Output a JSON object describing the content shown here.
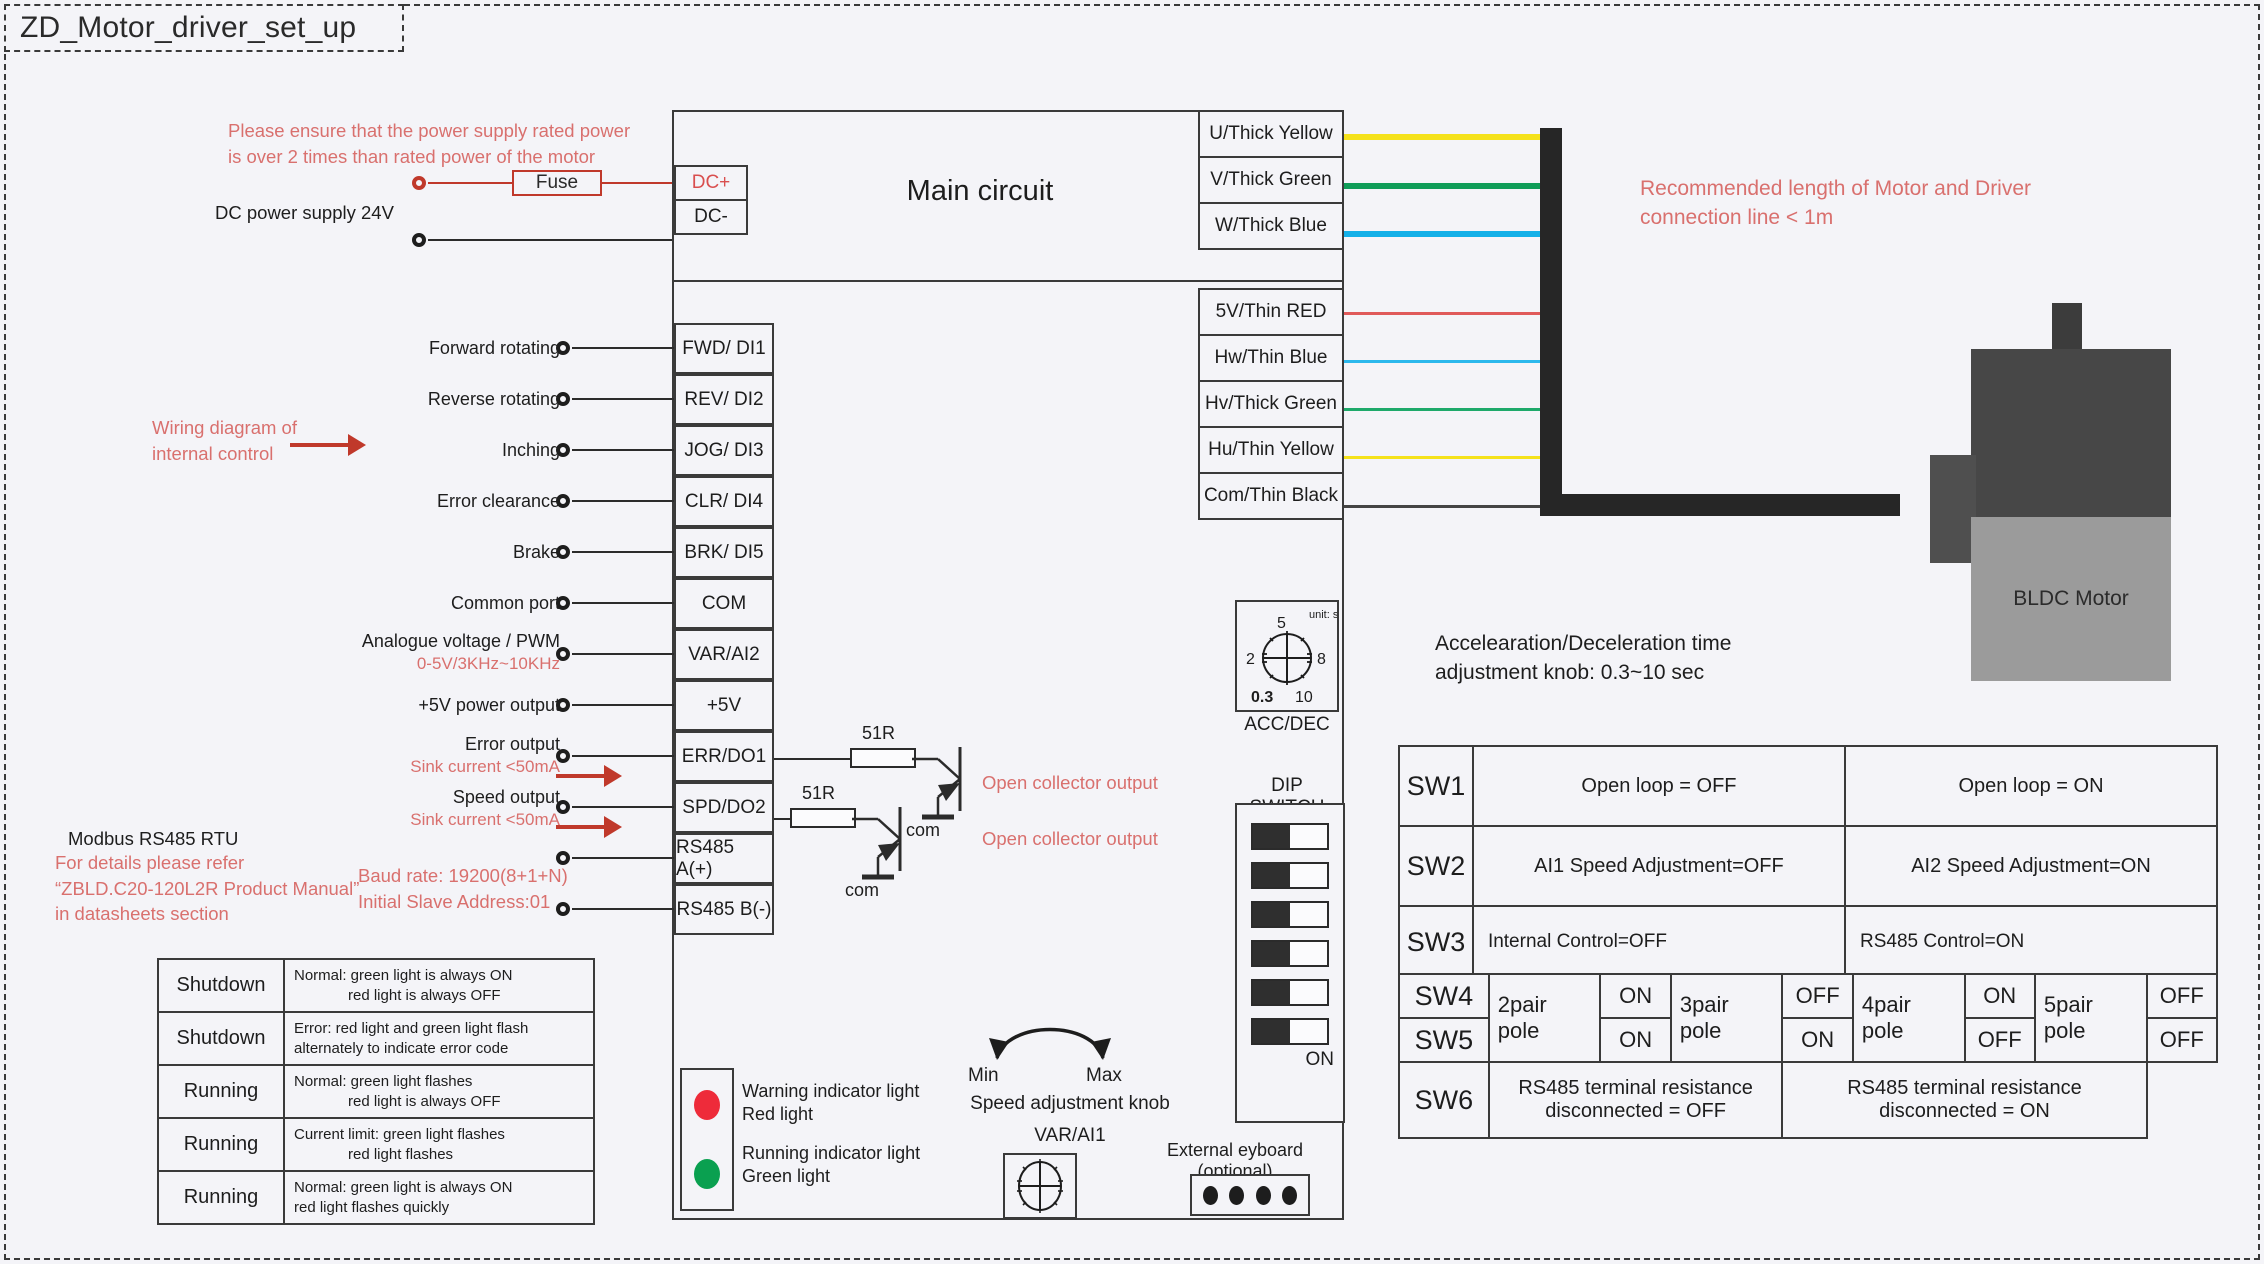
{
  "title": "ZD_Motor_driver_set_up",
  "notes": {
    "power_supply_warning": "Please ensure that the power supply rated power\nis over 2 times than rated power of the motor",
    "dc_supply": "DC power supply 24V",
    "fuse": "Fuse",
    "wiring_internal": "Wiring diagram of\ninternal control",
    "modbus": "Modbus RS485 RTU",
    "modbus_refer": "For details please refer\n“ZBLD.C20-120L2R Product Manual”\nin datasheets section",
    "baud": "Baud rate: 19200(8+1+N)\nInitial Slave Address:01",
    "recommended_length": "Recommended length of Motor and Driver\nconnection line < 1m",
    "accdec_text": "Accelearation/Deceleration time\nadjustment knob: 0.3~10 sec",
    "open_collector_1": "Open collector output",
    "open_collector_2": "Open collector output",
    "resistor_1": "51R",
    "resistor_2": "51R",
    "com_1": "com",
    "com_2": "com"
  },
  "main_circuit": {
    "label": "Main circuit"
  },
  "power_terminals": [
    {
      "label": "DC+",
      "red": true
    },
    {
      "label": "DC-",
      "red": false
    }
  ],
  "control_terminals": [
    {
      "label": "FWD/ DI1",
      "left": "Forward rotating",
      "sub": ""
    },
    {
      "label": "REV/ DI2",
      "left": "Reverse rotating",
      "sub": ""
    },
    {
      "label": "JOG/ DI3",
      "left": "Inching",
      "sub": ""
    },
    {
      "label": "CLR/ DI4",
      "left": "Error clearance",
      "sub": ""
    },
    {
      "label": "BRK/ DI5",
      "left": "Brake",
      "sub": ""
    },
    {
      "label": "COM",
      "left": "Common port",
      "sub": ""
    },
    {
      "label": "VAR/AI2",
      "left": "Analogue voltage / PWM",
      "sub": "0-5V/3KHz~10KHz"
    },
    {
      "label": "+5V",
      "left": "+5V power output",
      "sub": ""
    },
    {
      "label": "ERR/DO1",
      "left": "Error output",
      "sub": "Sink current <50mA"
    },
    {
      "label": "SPD/DO2",
      "left": "Speed output",
      "sub": "Sink current <50mA"
    },
    {
      "label": "RS485 A(+)",
      "left": "",
      "sub": ""
    },
    {
      "label": "RS485 B(-)",
      "left": "",
      "sub": ""
    }
  ],
  "motor_terminals_power": [
    {
      "label": "U/Thick Yellow",
      "color": "#f5e21b",
      "thick": true
    },
    {
      "label": "V/Thick Green",
      "color": "#0f9d58",
      "thick": true
    },
    {
      "label": "W/Thick Blue",
      "color": "#14b0e8",
      "thick": true
    }
  ],
  "motor_terminals_hall": [
    {
      "label": "5V/Thin RED",
      "color": "#e05a5a",
      "thick": false
    },
    {
      "label": "Hw/Thin Blue",
      "color": "#2cb8ec",
      "thick": false
    },
    {
      "label": "Hv/Thick Green",
      "color": "#1ea96a",
      "thick": false
    },
    {
      "label": "Hu/Thin Yellow",
      "color": "#f5e21b",
      "thick": false
    },
    {
      "label": "Com/Thin Black",
      "color": "#444444",
      "thick": false
    }
  ],
  "motor": {
    "name": "BLDC Motor"
  },
  "accdec_knob": {
    "caption": "ACC/DEC",
    "unit": "unit: s",
    "ticks": {
      "top": "5",
      "left": "2",
      "right": "8",
      "bottom_left": "0.3",
      "bottom_right": "10"
    }
  },
  "dip_switch": {
    "title": "DIP SWITCH",
    "on_label": "ON",
    "positions": [
      "OFF",
      "OFF",
      "OFF",
      "OFF",
      "OFF",
      "OFF"
    ]
  },
  "speed_knob": {
    "min": "Min",
    "max": "Max",
    "caption": "Speed adjustment knob",
    "name": "VAR/AI1"
  },
  "indicator_lights": [
    {
      "color": "#ee2b3a",
      "line1": "Warning indicator light",
      "line2": "Red light"
    },
    {
      "color": "#0aa050",
      "line1": "Running indicator light",
      "line2": "Green light"
    }
  ],
  "keyboard": {
    "caption": "External eyboard (optional)",
    "dots": 4
  },
  "status_table": [
    {
      "state": "Shutdown",
      "l1": "Normal: green light is always ON",
      "l2": "red light is always OFF",
      "indent": true
    },
    {
      "state": "Shutdown",
      "l1": "Error: red light and green light flash",
      "l2": "alternately to indicate error code",
      "indent": false
    },
    {
      "state": "Running",
      "l1": "Normal: green light flashes",
      "l2": "red light is always OFF",
      "indent": true
    },
    {
      "state": "Running",
      "l1": "Current limit: green light flashes",
      "l2": "red light flashes",
      "indent": true
    },
    {
      "state": "Running",
      "l1": "Normal: green light is always ON",
      "l2": "red light flashes quickly",
      "indent": false
    }
  ],
  "sw_table": {
    "rows": [
      {
        "id": "SW1",
        "left": "Open loop = OFF",
        "right": "Open loop = ON",
        "align": "center"
      },
      {
        "id": "SW2",
        "left": "AI1 Speed Adjustment=OFF",
        "right": "AI2 Speed Adjustment=ON",
        "align": "center"
      },
      {
        "id": "SW3",
        "left": "Internal Control=OFF",
        "right": "RS485 Control=ON",
        "align": "left"
      }
    ],
    "pole_row": {
      "id4": "SW4",
      "id5": "SW5",
      "groups": [
        {
          "pole": "2pair\npole",
          "sw4": "ON",
          "sw5": "ON"
        },
        {
          "pole": "3pair\npole",
          "sw4": "OFF",
          "sw5": "ON"
        },
        {
          "pole": "4pair\npole",
          "sw4": "ON",
          "sw5": "OFF"
        },
        {
          "pole": "5pair\npole",
          "sw4": "OFF",
          "sw5": "OFF"
        }
      ]
    },
    "sw6": {
      "id": "SW6",
      "left": "RS485 terminal resistance\ndisconnected = OFF",
      "right": "RS485 terminal resistance\ndisconnected = ON"
    }
  },
  "colors": {
    "accent_red": "#d9706e",
    "wire_red": "#c0392b",
    "line": "#3a3a3a",
    "bg": "#f4f4f8"
  }
}
